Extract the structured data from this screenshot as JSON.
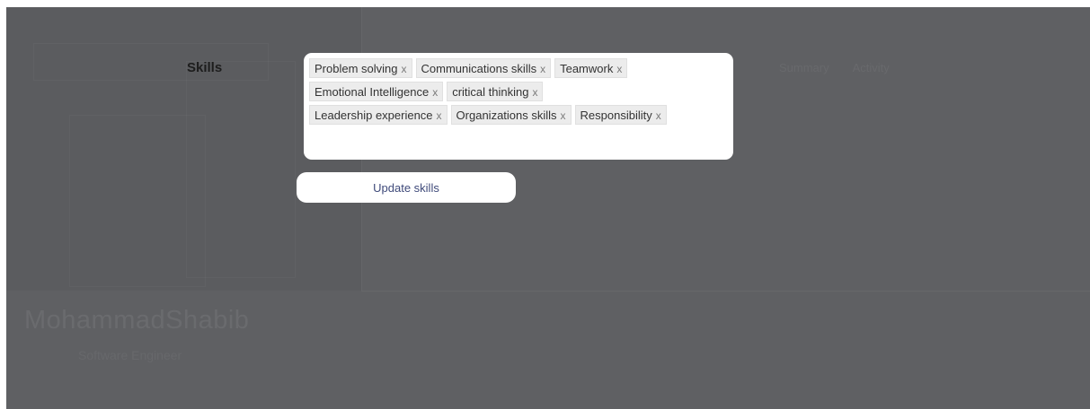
{
  "background": {
    "name": "MohammadShabib",
    "role": "Software Engineer",
    "tabs": [
      "Summary",
      "Activity"
    ]
  },
  "skills_panel": {
    "label": "Skills",
    "tags": [
      {
        "text": "Problem solving",
        "remove": "x"
      },
      {
        "text": "Communications skills",
        "remove": "x"
      },
      {
        "text": "Teamwork",
        "remove": "x"
      },
      {
        "text": "Emotional Intelligence",
        "remove": "x"
      },
      {
        "text": "critical thinking",
        "remove": "x"
      },
      {
        "text": "Leadership experience",
        "remove": "x"
      },
      {
        "text": "Organizations skills",
        "remove": "x"
      },
      {
        "text": "Responsibility",
        "remove": "x"
      }
    ],
    "input_value": "",
    "update_label": "Update skills"
  },
  "colors": {
    "overlay": "#5f6063",
    "tag_bg": "#ececec",
    "button_text": "#3f4a7a"
  }
}
